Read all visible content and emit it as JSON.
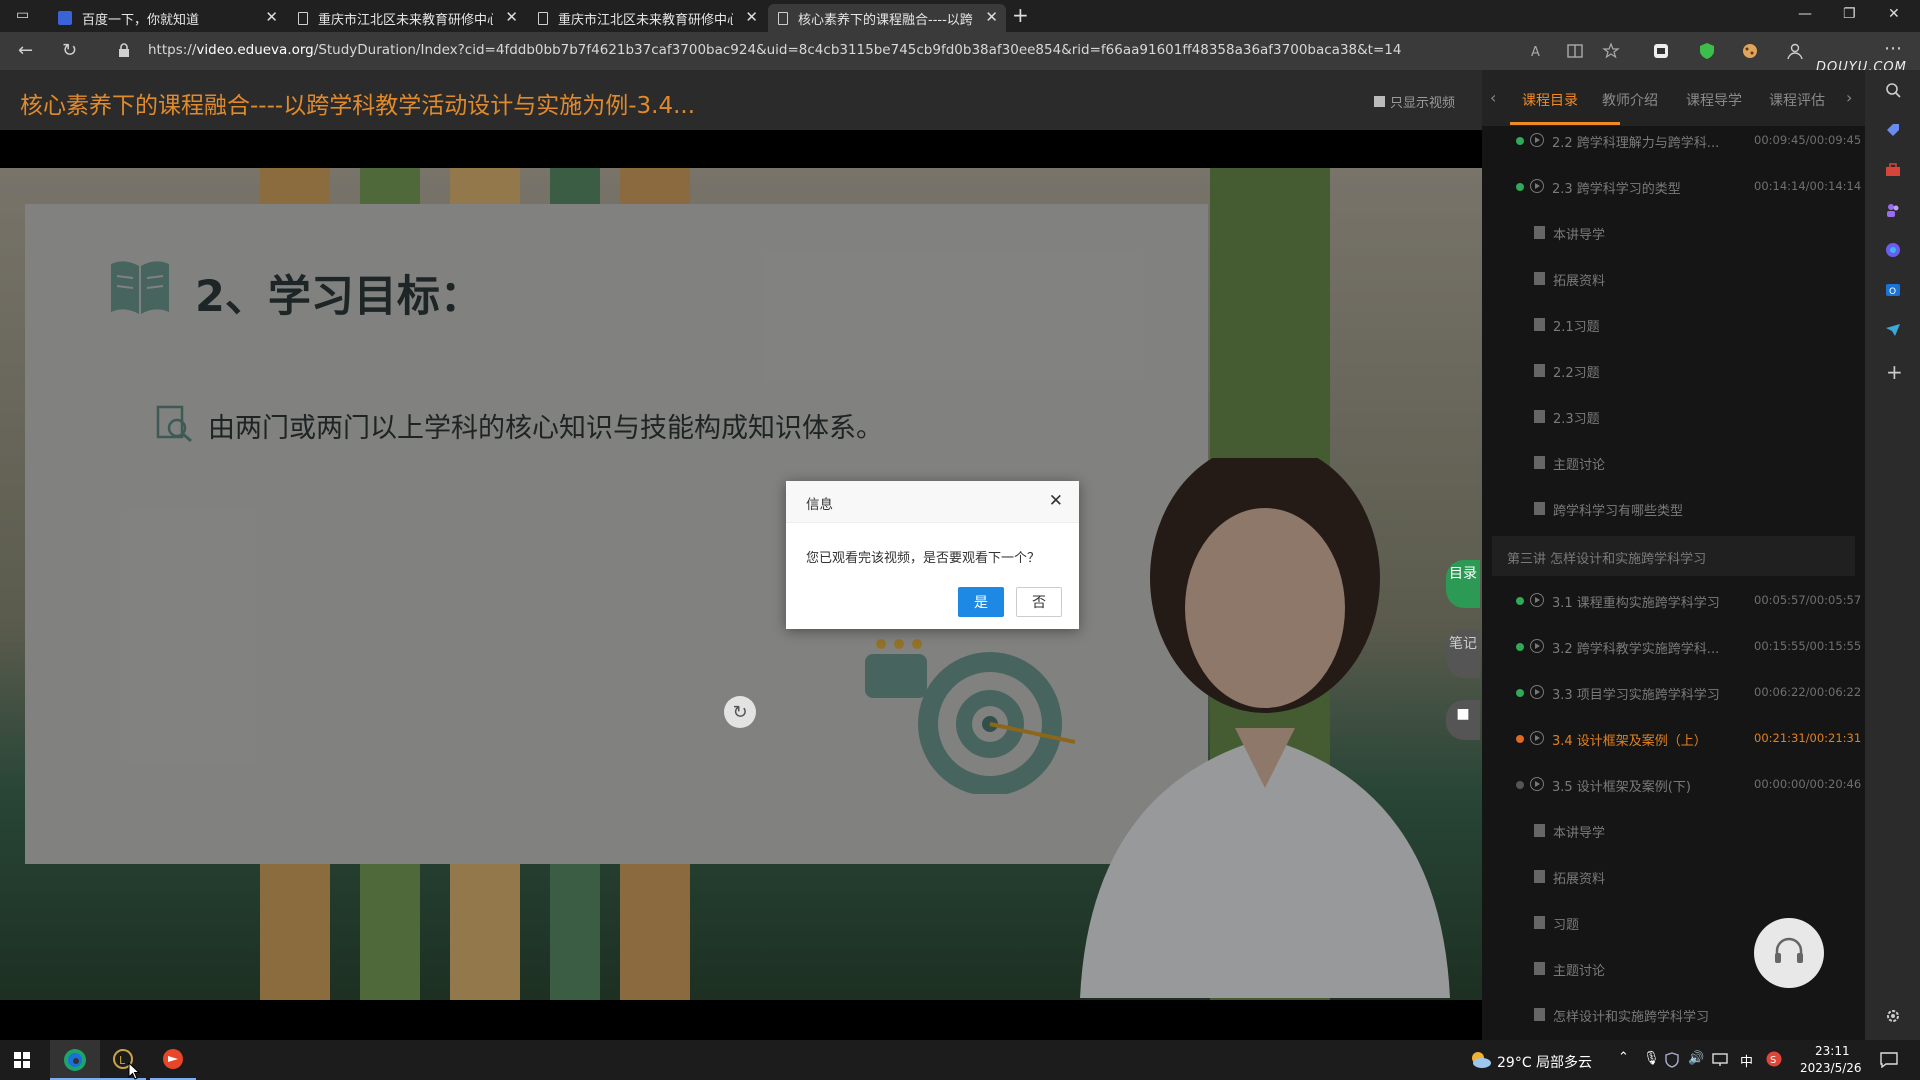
{
  "browser": {
    "tabs": [
      {
        "label": "百度一下，你就知道",
        "active": false
      },
      {
        "label": "重庆市江北区未来教育研修中心",
        "active": false
      },
      {
        "label": "重庆市江北区未来教育研修中心",
        "active": false
      },
      {
        "label": "核心素养下的课程融合----以跨学",
        "active": true
      }
    ],
    "new_tab": "+",
    "url_prefix": "https://",
    "url_host": "video.edueva.org",
    "url_path": "/StudyDuration/Index?cid=4fddb0bb7b7f4621b37caf3700bac924&uid=8c4cb3115be745cb9fd0b38af30ee854&rid=f66aa91601ff48358a36af3700baca38&t=14"
  },
  "watermark": "DOUYU.COM",
  "page": {
    "course_title": "核心素养下的课程融合----以跨学科教学活动设计与实施为例-3.4...",
    "video_only_label": "只显示视频"
  },
  "slide": {
    "title": "2、学习目标：",
    "line": "由两门或两门以上学科的核心知识与技能构成知识体系。"
  },
  "side_tabs": {
    "catalog": "目录",
    "notes": "笔记"
  },
  "dialog": {
    "title": "信息",
    "message": "您已观看完该视频，是否要观看下一个？",
    "yes": "是",
    "no": "否"
  },
  "panel": {
    "tabs": [
      "课程目录",
      "教师介绍",
      "课程导学",
      "课程评估"
    ],
    "items": [
      {
        "kind": "video",
        "label": "2.2 跨学科理解力与跨学科...",
        "time": "00:09:45/00:09:45",
        "status": "done"
      },
      {
        "kind": "video",
        "label": "2.3 跨学科学习的类型",
        "time": "00:14:14/00:14:14",
        "status": "done"
      },
      {
        "kind": "doc",
        "label": "本讲导学"
      },
      {
        "kind": "doc",
        "label": "拓展资料"
      },
      {
        "kind": "doc",
        "label": "2.1习题"
      },
      {
        "kind": "doc",
        "label": "2.2习题"
      },
      {
        "kind": "doc",
        "label": "2.3习题"
      },
      {
        "kind": "doc",
        "label": "主题讨论"
      },
      {
        "kind": "doc",
        "label": "跨学科学习有哪些类型"
      }
    ],
    "section": "第三讲 怎样设计和实施跨学科学习",
    "items2": [
      {
        "kind": "video",
        "label": "3.1 课程重构实施跨学科学习",
        "time": "00:05:57/00:05:57",
        "status": "done"
      },
      {
        "kind": "video",
        "label": "3.2 跨学科教学实施跨学科...",
        "time": "00:15:55/00:15:55",
        "status": "done"
      },
      {
        "kind": "video",
        "label": "3.3 项目学习实施跨学科学习",
        "time": "00:06:22/00:06:22",
        "status": "done"
      },
      {
        "kind": "video",
        "label": "3.4 设计框架及案例（上）",
        "time": "00:21:31/00:21:31",
        "status": "current"
      },
      {
        "kind": "video",
        "label": "3.5 设计框架及案例(下)",
        "time": "00:00:00/00:20:46",
        "status": "todo"
      },
      {
        "kind": "doc",
        "label": "本讲导学"
      },
      {
        "kind": "doc",
        "label": "拓展资料"
      },
      {
        "kind": "doc",
        "label": "习题"
      },
      {
        "kind": "doc",
        "label": "主题讨论"
      },
      {
        "kind": "doc",
        "label": "怎样设计和实施跨学科学习"
      }
    ]
  },
  "taskbar": {
    "weather": "29°C 局部多云",
    "ime": "中",
    "time": "23:11",
    "date": "2023/5/26"
  },
  "colors": {
    "accent": "#f08a24",
    "done": "#2eaa58",
    "primary_button": "#1e88e5"
  }
}
